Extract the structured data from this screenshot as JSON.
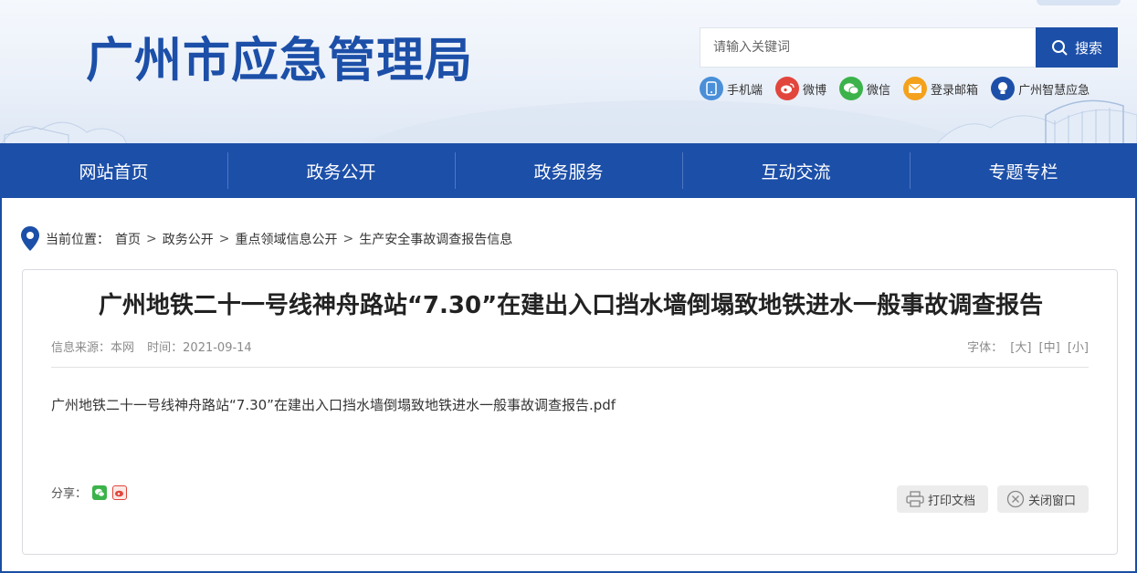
{
  "header": {
    "site_title": "广州市应急管理局",
    "search": {
      "placeholder": "请输入关键词",
      "button_label": "搜索"
    },
    "quick_links": [
      {
        "label": "手机端",
        "icon": "mobile-icon",
        "color": "#4a8fd8"
      },
      {
        "label": "微博",
        "icon": "weibo-icon",
        "color": "#e2453c"
      },
      {
        "label": "微信",
        "icon": "wechat-icon",
        "color": "#3bb34a"
      },
      {
        "label": "登录邮箱",
        "icon": "mail-icon",
        "color": "#f4a11c"
      },
      {
        "label": "广州智慧应急",
        "icon": "smart-bulb-icon",
        "color": "#1c4fa8"
      }
    ]
  },
  "nav": {
    "items": [
      {
        "label": "网站首页"
      },
      {
        "label": "政务公开"
      },
      {
        "label": "政务服务"
      },
      {
        "label": "互动交流"
      },
      {
        "label": "专题专栏"
      }
    ]
  },
  "breadcrumb": {
    "prefix": "当前位置：",
    "items": [
      "首页",
      "政务公开",
      "重点领域信息公开",
      "生产安全事故调查报告信息"
    ],
    "separator": ">"
  },
  "article": {
    "title": "广州地铁二十一号线神舟路站“7.30”在建出入口挡水墙倒塌致地铁进水一般事故调查报告",
    "source": "信息来源：本网",
    "time": "时间：2021-09-14",
    "font_size": {
      "label": "字体：",
      "large": "[大]",
      "medium": "[中]",
      "small": "[小]"
    },
    "attachment": "广州地铁二十一号线神舟路站“7.30”在建出入口挡水墙倒塌致地铁进水一般事故调查报告.pdf",
    "share_label": "分享：",
    "print_label": "打印文档",
    "close_label": "关闭窗口"
  },
  "colors": {
    "brand": "#1c4fa8",
    "border": "#1a4ea3"
  }
}
